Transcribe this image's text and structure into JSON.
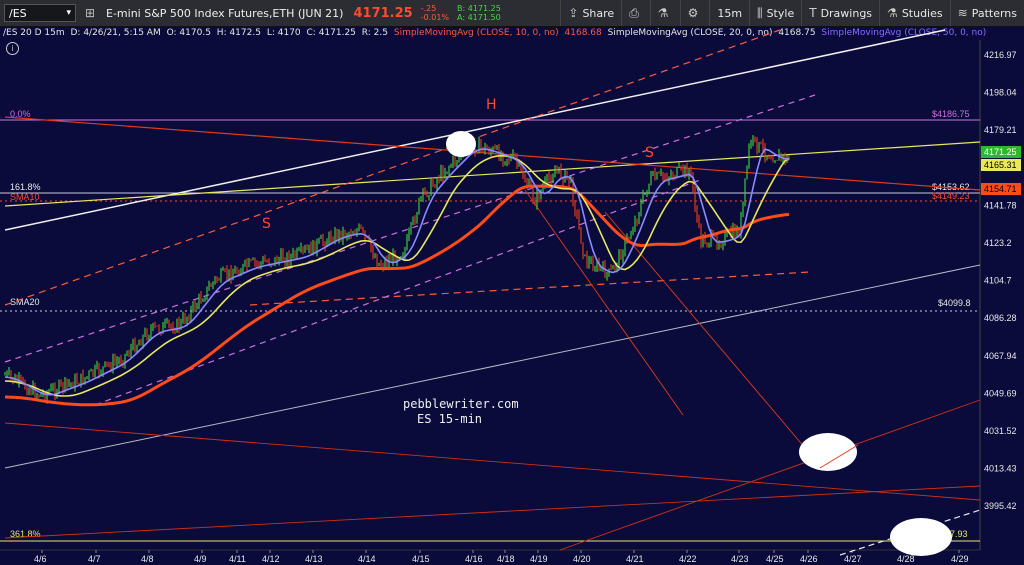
{
  "toolbar": {
    "symbol": "/ES",
    "description": "E-mini S&P 500 Index Futures,ETH (JUN 21)",
    "last_price": "4171.25",
    "change": "-.25",
    "change_pct": "-0.01%",
    "bid": "B: 4171.25",
    "ask": "A: 4171.50",
    "buttons": {
      "share": "Share",
      "interval": "15m",
      "style": "Style",
      "drawings": "Drawings",
      "studies": "Studies",
      "patterns": "Patterns"
    }
  },
  "header": {
    "symbol_tf": "/ES 20 D 15m",
    "datetime": "D: 4/26/21, 5:15 AM",
    "open": "O: 4170.5",
    "high": "H: 4172.5",
    "low": "L: 4170",
    "close": "C: 4171.25",
    "range": "R: 2.5",
    "sma10_label": "SimpleMovingAvg (CLOSE, 10, 0, no)",
    "sma10_value": "4168.68",
    "sma20_label": "SimpleMovingAvg (CLOSE, 20, 0, no)",
    "sma20_value": "4168.75",
    "sma50_label": "SimpleMovingAvg (CLOSE, 50, 0, no)"
  },
  "chart": {
    "y_axis": [
      "4216.97",
      "4198.04",
      "4179.21",
      "4160.45",
      "4141.78",
      "4123.2",
      "4104.7",
      "4086.28",
      "4067.94",
      "4049.69",
      "4031.52",
      "4013.43",
      "3995.42"
    ],
    "x_axis": [
      "4/6",
      "4/7",
      "4/8",
      "4/9",
      "4/11",
      "4/12",
      "4/13",
      "4/14",
      "4/15",
      "4/16",
      "4/18",
      "4/19",
      "4/20",
      "4/21",
      "4/22",
      "4/23",
      "4/25",
      "4/26",
      "4/27",
      "4/28",
      "4/29"
    ],
    "price_tags": {
      "last": "4171.25",
      "sma_a": "4165.31",
      "sma_b": "4154.71"
    },
    "levels": {
      "fib_0": "0.0%",
      "fib_0_price": "$4186.75",
      "fib_161": "161.8%",
      "fib_161_price": "$4153.62",
      "sma10_tag": "SMA10",
      "sma10_price": "$4149.23",
      "sma20_tag": "SMA20",
      "sma20_price": "$4099.8",
      "fib_361": "361.8%",
      "fib_361_price": "$3997.93"
    },
    "annotations": {
      "left_shoulder": "S",
      "head": "H",
      "right_shoulder": "S",
      "watermark_1": "pebblewriter.com",
      "watermark_2": "ES 15-min"
    },
    "colors": {
      "background": "#0a0b3a",
      "price_up": "#3cc83c",
      "price_down": "#e03a1a",
      "sma10": "#7b7bff",
      "sma20": "#e8e85a",
      "sma50": "#ff4a1a",
      "channel": "#d070e0",
      "fib": "#d070e0"
    }
  }
}
